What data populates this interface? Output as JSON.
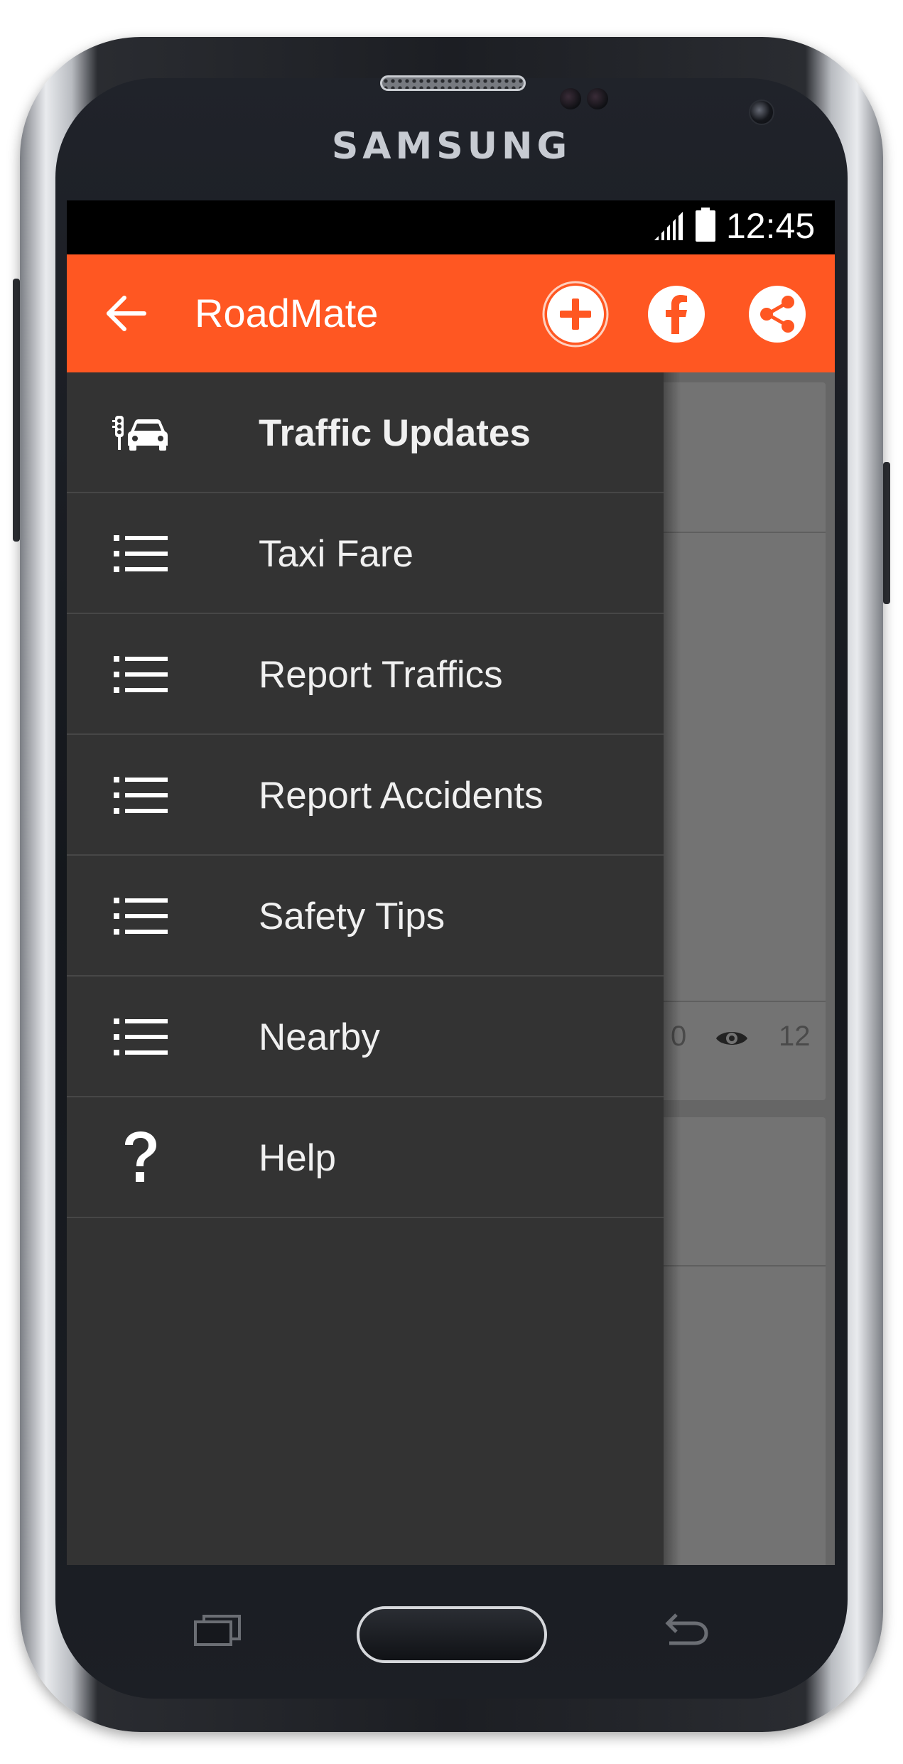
{
  "device": {
    "brand": "SAMSUNG"
  },
  "status_bar": {
    "time": "12:45",
    "icons": [
      "signal-icon",
      "battery-icon"
    ]
  },
  "app_bar": {
    "title": "RoadMate",
    "background": "#ff5722",
    "actions": [
      "add-icon",
      "facebook-icon",
      "share-icon"
    ]
  },
  "drawer": {
    "background": "#333333",
    "items": [
      {
        "label": "Traffic Updates",
        "icon": "traffic-car-icon",
        "active": true
      },
      {
        "label": "Taxi Fare",
        "icon": "list-icon"
      },
      {
        "label": "Report Traffics",
        "icon": "list-icon"
      },
      {
        "label": "Report Accidents",
        "icon": "list-icon"
      },
      {
        "label": "Safety Tips",
        "icon": "list-icon"
      },
      {
        "label": "Nearby",
        "icon": "list-icon"
      },
      {
        "label": "Help",
        "icon": "help-icon"
      }
    ]
  },
  "background_card": {
    "count_left": "0",
    "views": "12"
  },
  "nav_bar": {
    "buttons": [
      "recent-apps-icon",
      "home-button",
      "back-nav-icon"
    ]
  }
}
